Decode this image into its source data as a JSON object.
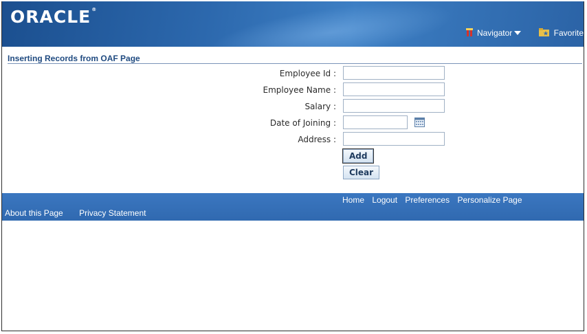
{
  "header": {
    "brand": "ORACLE",
    "brand_mark": "®",
    "navigator_label": "Navigator",
    "favorites_label": "Favorite"
  },
  "page": {
    "title": "Inserting Records from OAF Page"
  },
  "form": {
    "fields": [
      {
        "label": "Employee Id :",
        "value": ""
      },
      {
        "label": "Employee Name :",
        "value": ""
      },
      {
        "label": "Salary :",
        "value": ""
      },
      {
        "label": "Date of Joining :",
        "value": ""
      },
      {
        "label": "Address :",
        "value": ""
      }
    ],
    "add_label": "Add",
    "clear_label": "Clear"
  },
  "footer": {
    "global_links": [
      "Home",
      "Logout",
      "Preferences",
      "Personalize Page"
    ],
    "links": [
      "About this Page",
      "Privacy Statement"
    ]
  },
  "colors": {
    "header": "#2c68ad",
    "footer": "#3069b0",
    "title": "#1f4a80"
  }
}
